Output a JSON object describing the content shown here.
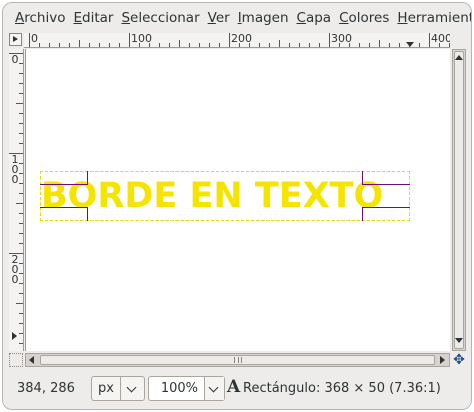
{
  "menubar": {
    "items": [
      {
        "mnemonic": "A",
        "rest": "rchivo"
      },
      {
        "mnemonic": "E",
        "rest": "ditar"
      },
      {
        "mnemonic": "S",
        "rest": "eleccionar"
      },
      {
        "mnemonic": "V",
        "rest": "er"
      },
      {
        "mnemonic": "I",
        "rest": "magen"
      },
      {
        "mnemonic": "C",
        "rest": "apa"
      },
      {
        "mnemonic": "C",
        "rest": "olores"
      },
      {
        "mnemonic": "H",
        "rest": "erramienta"
      }
    ]
  },
  "rulers": {
    "horizontal_labels": [
      "0",
      "100",
      "200",
      "300",
      "400"
    ],
    "vertical_labels": [
      "0",
      "100",
      "200"
    ]
  },
  "canvas": {
    "text": "BORDE EN TEXTO",
    "text_color": "#f5e400",
    "background": "#ffffff",
    "handle_color": "#6a0f7a"
  },
  "statusbar": {
    "coords": "384, 286",
    "unit": "px",
    "zoom": "100%",
    "tool_icon": "A",
    "message": "Rectángulo: 368 × 50  (7.36:1)"
  },
  "icons": {
    "navigate": "navigate-icon",
    "quickmask": "quickmask-icon",
    "menu_arrow": "menu-arrow-icon"
  }
}
